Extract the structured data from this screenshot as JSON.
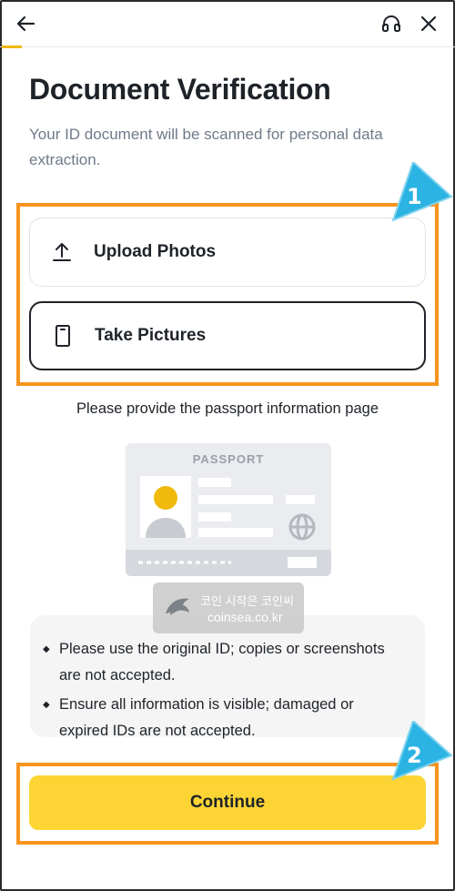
{
  "header": {
    "back_icon": "arrow-left-icon",
    "support_icon": "headset-icon",
    "close_icon": "close-icon",
    "progress_color": "#F0B90B"
  },
  "page": {
    "title": "Document Verification",
    "subtitle": "Your ID document will be scanned for personal data extraction."
  },
  "options": [
    {
      "icon": "upload-icon",
      "label": "Upload Photos"
    },
    {
      "icon": "phone-icon",
      "label": "Take Pictures"
    }
  ],
  "hint": "Please provide the passport information page",
  "illustration": {
    "passport_label": "PASSPORT"
  },
  "watermark": {
    "korean": "코인 시작은 코인씨",
    "site": "coinsea.co.kr"
  },
  "notes": [
    "Please use the original ID; copies or screenshots are not accepted.",
    "Ensure all information is visible; damaged or expired IDs are not accepted."
  ],
  "continue_label": "Continue",
  "annotations": {
    "marker_1": "1",
    "marker_2": "2",
    "highlight_color": "#F7941D",
    "marker_color": "#2BB3E3"
  },
  "colors": {
    "accent": "#FCD535",
    "text": "#1E2329",
    "muted": "#707A8A"
  }
}
